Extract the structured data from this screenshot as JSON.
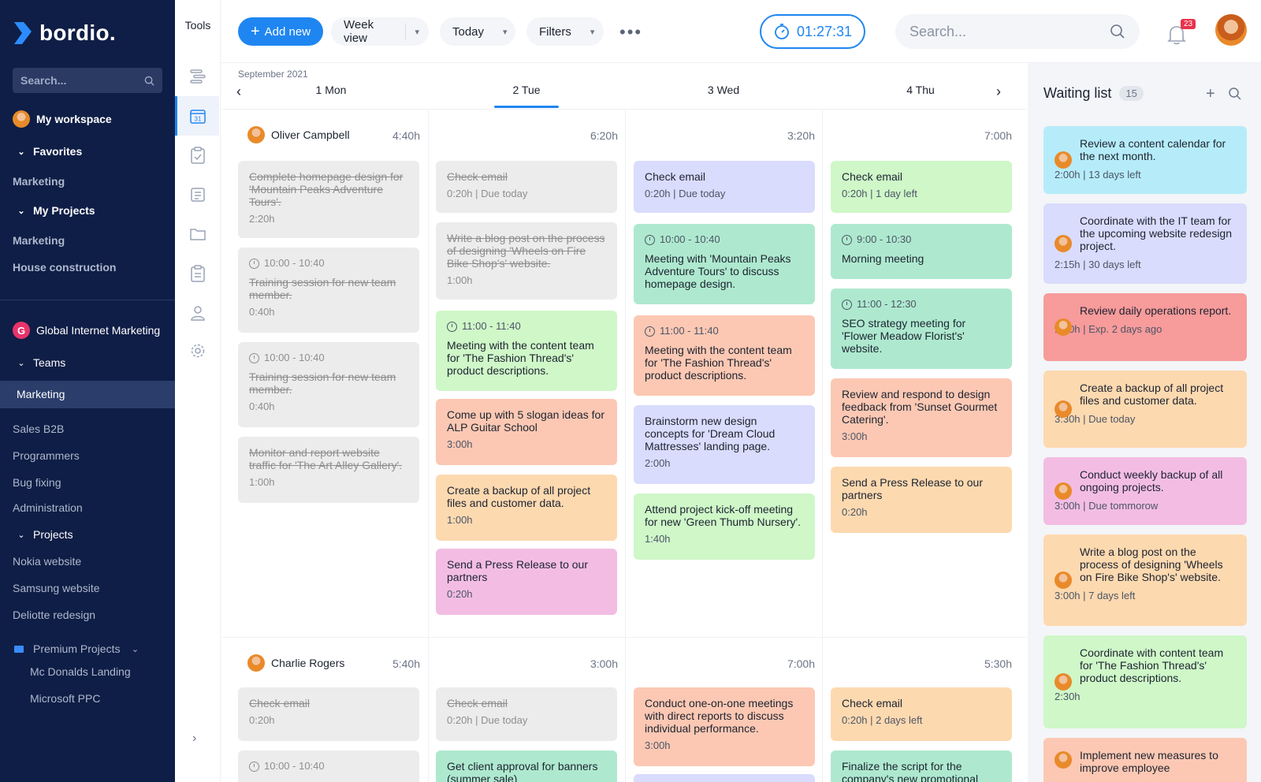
{
  "sidebar": {
    "brand": "bordio.",
    "search_placeholder": "Search...",
    "workspace": "My workspace",
    "favorites": "Favorites",
    "fav_marketing": "Marketing",
    "my_projects": "My Projects",
    "mp_marketing": "Marketing",
    "mp_house": "House construction",
    "org_letter": "G",
    "org_name": "Global Internet Marketing",
    "teams": "Teams",
    "team_items": [
      "Marketing",
      "Sales B2B",
      "Programmers",
      "Bug fixing",
      "Administration"
    ],
    "projects": "Projects",
    "project_items": [
      "Nokia website",
      "Samsung website",
      "Deliotte redesign"
    ],
    "premium": "Premium Projects",
    "premium_items": [
      "Mc Donalds Landing",
      "Microsoft PPC"
    ]
  },
  "tools": {
    "label": "Tools",
    "calendar_day": "31"
  },
  "toolbar": {
    "add_new": "Add new",
    "week_view": "Week view",
    "today": "Today",
    "filters": "Filters",
    "timer": "01:27:31",
    "search_placeholder": "Search...",
    "notifications": "23"
  },
  "calendar": {
    "month": "September 2021",
    "days": [
      "1 Mon",
      "2 Tue",
      "3 Wed",
      "4 Thu"
    ],
    "rows": [
      {
        "user": "Oliver Campbell",
        "totals": [
          "4:40h",
          "6:20h",
          "3:20h",
          "7:00h"
        ]
      },
      {
        "user": "Charlie Rogers",
        "totals": [
          "5:40h",
          "3:00h",
          "7:00h",
          "5:30h"
        ]
      }
    ],
    "cards": {
      "r1_mon": [
        {
          "title": "Complete homepage design for 'Mountain Peaks Adventure Tours'.",
          "meta": "2:20h"
        },
        {
          "time": "10:00 - 10:40",
          "title": "Training session for new team member.",
          "meta": "0:40h"
        },
        {
          "time": "10:00 - 10:40",
          "title": "Training session for new team member.",
          "meta": "0:40h"
        },
        {
          "title": "Monitor and report website traffic for 'The Art Alley Gallery'.",
          "meta": "1:00h"
        }
      ],
      "r1_tue": [
        {
          "title": "Check email",
          "meta": "0:20h | Due today"
        },
        {
          "title": "Write a blog post on the process of designing 'Wheels on Fire Bike Shop's' website.",
          "meta": "1:00h"
        },
        {
          "time": "11:00 - 11:40",
          "title": "Meeting with the content team for 'The Fashion Thread's' product descriptions."
        },
        {
          "title": "Come up with 5 slogan ideas for ALP Guitar School",
          "meta": "3:00h"
        },
        {
          "title": "Create a backup of all project files and customer data.",
          "meta": "1:00h"
        },
        {
          "title": "Send a Press Release to our partners",
          "meta": "0:20h"
        }
      ],
      "r1_wed": [
        {
          "title": "Check email",
          "meta": "0:20h | Due today"
        },
        {
          "time": "10:00 - 10:40",
          "title": "Meeting with 'Mountain Peaks Adventure Tours' to discuss homepage design."
        },
        {
          "time": "11:00 - 11:40",
          "title": "Meeting with the content team for 'The Fashion Thread's' product descriptions."
        },
        {
          "title": "Brainstorm new design concepts for 'Dream Cloud Mattresses' landing page.",
          "meta": "2:00h"
        },
        {
          "title": "Attend project kick-off meeting for new 'Green Thumb Nursery'.",
          "meta": "1:40h"
        }
      ],
      "r1_thu": [
        {
          "title": "Check email",
          "meta": "0:20h | 1 day left"
        },
        {
          "time": "9:00 - 10:30",
          "title": "Morning meeting"
        },
        {
          "time": "11:00 - 12:30",
          "title": "SEO strategy meeting for 'Flower Meadow Florist's' website."
        },
        {
          "title": "Review and respond to design feedback from 'Sunset Gourmet Catering'.",
          "meta": "3:00h"
        },
        {
          "title": "Send a Press Release to our partners",
          "meta": "0:20h"
        }
      ],
      "r2_mon": [
        {
          "title": "Check email",
          "meta": "0:20h"
        },
        {
          "time": "10:00 - 10:40"
        }
      ],
      "r2_tue": [
        {
          "title": "Check email",
          "meta": "0:20h | Due today"
        },
        {
          "title": "Get client approval for banners (summer sale)"
        }
      ],
      "r2_wed": [
        {
          "title": "Conduct one-on-one meetings with direct reports to discuss individual performance.",
          "meta": "3:00h"
        }
      ],
      "r2_thu": [
        {
          "title": "Check email",
          "meta": "0:20h | 2 days left"
        },
        {
          "title": "Finalize the script for the company's new promotional"
        }
      ]
    }
  },
  "waiting_list": {
    "title": "Waiting list",
    "count": "15",
    "items": [
      {
        "title": "Review a content calendar for the next month.",
        "meta": "2:00h | 13 days left"
      },
      {
        "title": "Coordinate with the IT team for the upcoming website redesign project.",
        "meta": "2:15h | 30 days left"
      },
      {
        "title": "Review daily operations report.",
        "meta": "1:40h | Exp. 2 days ago"
      },
      {
        "title": "Create a backup of all project files and customer data.",
        "meta": "3:30h | Due today"
      },
      {
        "title": "Conduct weekly backup of all ongoing projects.",
        "meta": "3:00h | Due tommorow"
      },
      {
        "title": "Write a blog post on the process of designing 'Wheels on Fire Bike Shop's' website.",
        "meta": "3:00h | 7 days left"
      },
      {
        "title": "Coordinate with content team for 'The Fashion Thread's' product descriptions.",
        "meta": "2:30h"
      },
      {
        "title": "Implement new measures to improve employee"
      }
    ]
  },
  "colors": {
    "sidebar_bg": "#0f1e46",
    "accent": "#1f86f1",
    "purple": "#d9dcfc",
    "green": "#cff7c8",
    "teal": "#aee9cf",
    "salmon": "#fcc8b3",
    "orange": "#fdd9b0",
    "pink": "#f3bde3",
    "cyan": "#b6ecf9",
    "red": "#f79b9b"
  }
}
